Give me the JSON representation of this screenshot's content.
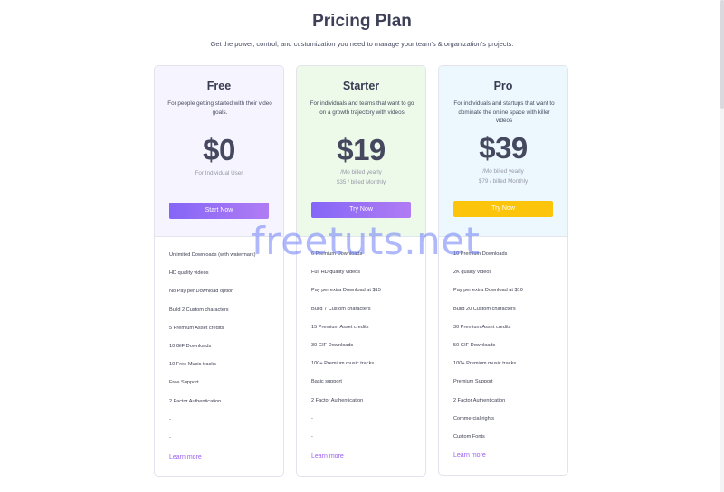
{
  "header": {
    "title": "Pricing Plan",
    "subtitle": "Get the power, control, and customization you need to manage your team’s & organization’s projects."
  },
  "plans": [
    {
      "name": "Free",
      "description": "For people getting started with their video goals.",
      "price": "$0",
      "price_note_1": "For Individual User",
      "price_note_2": "",
      "cta_label": "Start Now",
      "features": [
        "Unlimited Downloads (with watermark)",
        "HD quality videos",
        "No Pay per Download option",
        "Build 2 Custom characters",
        "5 Premium Asset credits",
        "10 GIF Downloads",
        "10 Free Music tracks",
        "Free Support",
        "2 Factor Authentication",
        "-",
        "-"
      ],
      "learn_more": "Learn more"
    },
    {
      "name": "Starter",
      "description": "For individuals and teams that want to go on a growth trajectory with videos",
      "price": "$19",
      "price_note_1": "/Mo billed yearly",
      "price_note_2": "$35 / billed Monthly",
      "cta_label": "Try Now",
      "features": [
        "6 Premium Downloads",
        "Full HD quality videos",
        "Pay per extra Download at $15",
        "Build 7 Custom characters",
        "15 Premium Asset credits",
        "30 GIF Downloads",
        "100+ Premium music tracks",
        "Basic support",
        "2 Factor Authentication",
        "-",
        "-"
      ],
      "learn_more": "Learn more"
    },
    {
      "name": "Pro",
      "description": "For individuals and startups that want to dominate the online space with killer videos",
      "price": "$39",
      "price_note_1": "/Mo billed yearly",
      "price_note_2": "$79 / billed Monthly",
      "cta_label": "Try Now",
      "features": [
        "10 Premium Downloads",
        "2K quality videos",
        "Pay per extra Download at $10",
        "Build 20 Custom characters",
        "30 Premium Asset credits",
        "50 GIF Downloads",
        "100+ Premium music tracks",
        "Premium Support",
        "2 Factor Authentication",
        "Commercial rights",
        "Custom Fonts"
      ],
      "learn_more": "Learn more"
    }
  ],
  "watermark": "freetuts.net",
  "colors": {
    "free_bg": "#f6f5ff",
    "starter_bg": "#edfaea",
    "pro_bg": "#ecf8fe",
    "purple_button": "#8566f7",
    "yellow_button": "#fcc50c",
    "link": "#9a5ef0"
  }
}
